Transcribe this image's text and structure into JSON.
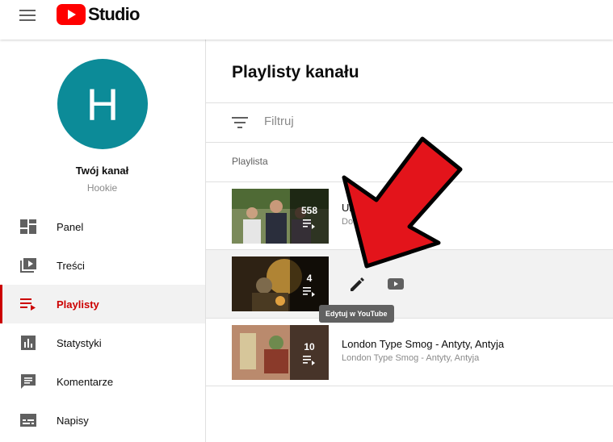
{
  "header": {
    "logo_text": "Studio",
    "logo_color": "#ff0000"
  },
  "sidebar": {
    "avatar_letter": "H",
    "avatar_color": "#0c8b98",
    "channel_name": "Twój kanał",
    "channel_handle": "Hookie",
    "items": [
      {
        "label": "Panel",
        "icon": "dashboard-icon",
        "active": false
      },
      {
        "label": "Treści",
        "icon": "content-icon",
        "active": false
      },
      {
        "label": "Playlisty",
        "icon": "playlist-icon",
        "active": true
      },
      {
        "label": "Statystyki",
        "icon": "analytics-icon",
        "active": false
      },
      {
        "label": "Komentarze",
        "icon": "comments-icon",
        "active": false
      },
      {
        "label": "Napisy",
        "icon": "subtitles-icon",
        "active": false
      }
    ],
    "active_color": "#cc0000"
  },
  "main": {
    "title": "Playlisty kanału",
    "filter_placeholder": "Filtruj",
    "column_header": "Playlista",
    "rows": [
      {
        "title": "Ulubi",
        "subtitle": "Doda",
        "count": "558"
      },
      {
        "title": "",
        "subtitle": "",
        "count": "4"
      },
      {
        "title": "London Type Smog - Antyty, Antyja",
        "subtitle": "London Type Smog - Antyty, Antyja",
        "count": "10"
      }
    ],
    "tooltip": "Edytuj w YouTube"
  },
  "annotation": {
    "arrow_color": "#e3141b"
  }
}
